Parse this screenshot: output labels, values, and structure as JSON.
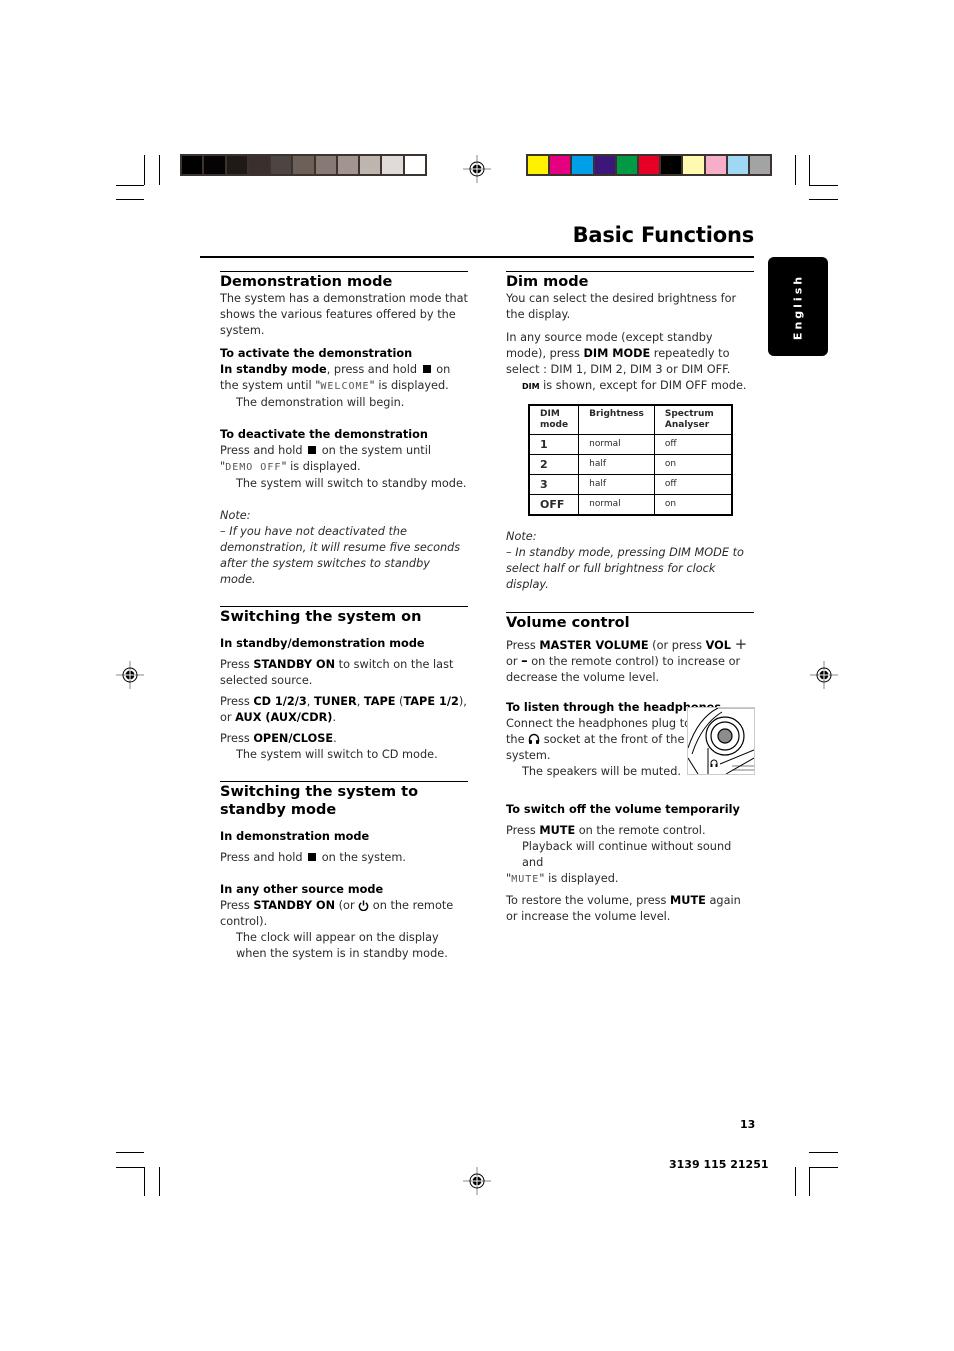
{
  "print_marks": {
    "grayscale_bar": [
      "#000000",
      "#050304",
      "#201a17",
      "#3a2f2b",
      "#4d453f",
      "#6c6059",
      "#877a74",
      "#a2958f",
      "#beb5af",
      "#e0dbd8",
      "#ffffff"
    ],
    "color_bar": [
      "#fff100",
      "#e4007f",
      "#00a0e9",
      "#3c1678",
      "#009944",
      "#e60026",
      "#000000",
      "#fffaaf",
      "#f7aec8",
      "#9ed8f5",
      "#a3a3a3"
    ]
  },
  "header": {
    "title": "Basic Functions",
    "language_tab": "English"
  },
  "left_column": {
    "demo": {
      "title": "Demonstration mode",
      "intro": "The system has a demonstration mode that shows the various features offered by the system.",
      "activate": {
        "title": "To activate the demonstration",
        "line1_bold": "In standby mode",
        "line1_rest": ", press and hold",
        "line1_end": "on the",
        "line2_pre": "system until \"",
        "display": "WELCOME",
        "line2_post": "\" is displayed.",
        "result": "The demonstration will begin."
      },
      "deactivate": {
        "title": "To deactivate the demonstration",
        "line1_pre": "Press and hold",
        "line1_post": "on the system until",
        "display": "DEMO OFF",
        "line2_post": "\" is displayed.",
        "result": "The system will switch to standby mode."
      },
      "note_label": "Note:",
      "note_text": "–  If you have not deactivated the demonstration, it will resume five seconds after the system switches to standby mode."
    },
    "switch_on": {
      "title": "Switching the system on",
      "subtitle": "In standby/demonstration mode",
      "p1_pre": "Press ",
      "p1_bold": "STANDBY ON",
      "p1_post": " to switch on the last selected source.",
      "p2_pre": "Press ",
      "p2_b1": "CD 1/2/3",
      "p2_s1": ", ",
      "p2_b2": "TUNER",
      "p2_s2": ", ",
      "p2_b3": "TAPE",
      "p2_s3": " (",
      "p2_b4": "TAPE 1/2",
      "p2_s4": "), or ",
      "p2_b5": "AUX (AUX/CDR)",
      "p2_s5": ".",
      "p3_pre": "Press ",
      "p3_bold": "OPEN/CLOSE",
      "p3_post": ".",
      "result": "The system will switch to CD mode."
    },
    "standby": {
      "title": "Switching the system to standby mode",
      "sub1": "In demonstration mode",
      "sub1_pre": "Press and hold",
      "sub1_post": "on the system.",
      "sub2": "In any other source mode",
      "sub2_pre": "Press ",
      "sub2_bold": "STANDBY ON",
      "sub2_mid": " (or",
      "sub2_post": "on the remote control).",
      "result": "The clock will appear on the display when the system is in standby mode."
    }
  },
  "right_column": {
    "dim": {
      "title": "Dim mode",
      "intro": "You can select the desired brightness for the display.",
      "p_pre": "In any source mode (except standby mode), press ",
      "p_bold": "DIM MODE",
      "p_post": " repeatedly to select : DIM 1, DIM 2, DIM 3 or DIM OFF.",
      "shown_badge": "DIM",
      "shown_text": " is shown, except for DIM OFF mode.",
      "table": {
        "headers": [
          "DIM mode",
          "Brightness",
          "Spectrum Analyser"
        ],
        "rows": [
          [
            "1",
            "normal",
            "off"
          ],
          [
            "2",
            "half",
            "on"
          ],
          [
            "3",
            "half",
            "off"
          ],
          [
            "OFF",
            "normal",
            "on"
          ]
        ]
      },
      "note_label": "Note:",
      "note_text": "–  In standby mode, pressing DIM MODE to select half or full brightness for clock display."
    },
    "volume": {
      "title": "Volume control",
      "p_pre": "Press ",
      "p_b1": "MASTER VOLUME",
      "p_mid": " (or press ",
      "p_b2": "VOL",
      "p_plus": "+",
      "p_or": "or",
      "p_minus": "–",
      "p_post": " on the remote control) to increase or decrease the volume level.",
      "headphones": {
        "title": "To listen through the headphones",
        "line1": "Connect the headphones plug to",
        "line2_pre": "the",
        "line2_post": "socket at the front of the",
        "line3": "system.",
        "result": "The speakers will be muted."
      },
      "mute": {
        "title": "To switch off the volume temporarily",
        "p_pre": "Press ",
        "p_bold": "MUTE",
        "p_post": " on the remote control.",
        "result1": "Playback will continue without sound and",
        "display": "MUTE",
        "result2": "\" is displayed.",
        "restore_pre": "To restore the volume, press ",
        "restore_bold": "MUTE",
        "restore_post": " again or increase the volume level."
      }
    }
  },
  "footer": {
    "page_number": "13",
    "doc_code": "3139 115 21251"
  }
}
